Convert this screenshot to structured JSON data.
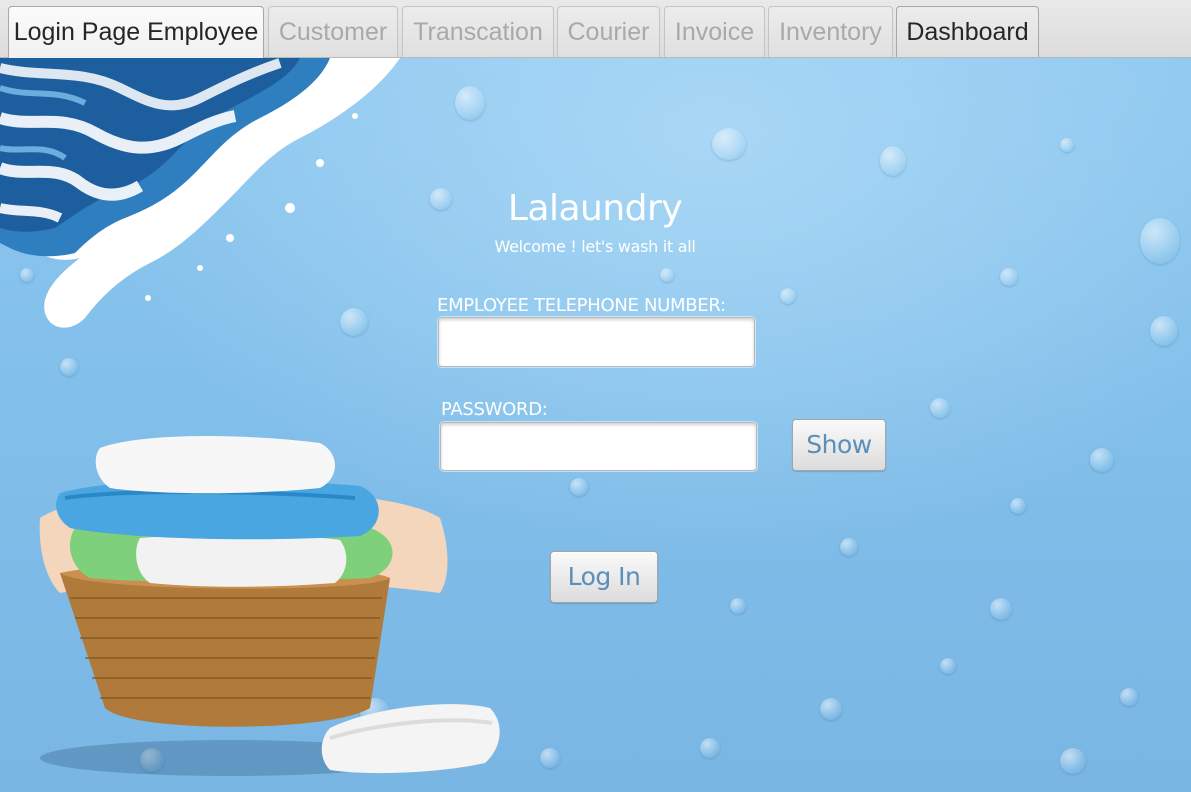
{
  "tabs": [
    {
      "label": "Login Page Employee",
      "state": "selected"
    },
    {
      "label": "Customer",
      "state": "disabled"
    },
    {
      "label": "Transcation",
      "state": "disabled"
    },
    {
      "label": "Courier",
      "state": "disabled"
    },
    {
      "label": "Invoice",
      "state": "disabled"
    },
    {
      "label": "Inventory",
      "state": "disabled"
    },
    {
      "label": "Dashboard",
      "state": "enabled"
    }
  ],
  "login": {
    "title": "Lalaundry",
    "subtitle": "Welcome ! let's wash it all",
    "phone_label": "EMPLOYEE TELEPHONE NUMBER:",
    "phone_value": "",
    "password_label": "PASSWORD:",
    "password_value": "",
    "show_button": "Show",
    "login_button": "Log In"
  },
  "colors": {
    "background": "#8cc7ef",
    "button_text": "#5b8fb9",
    "text": "#ffffff"
  }
}
